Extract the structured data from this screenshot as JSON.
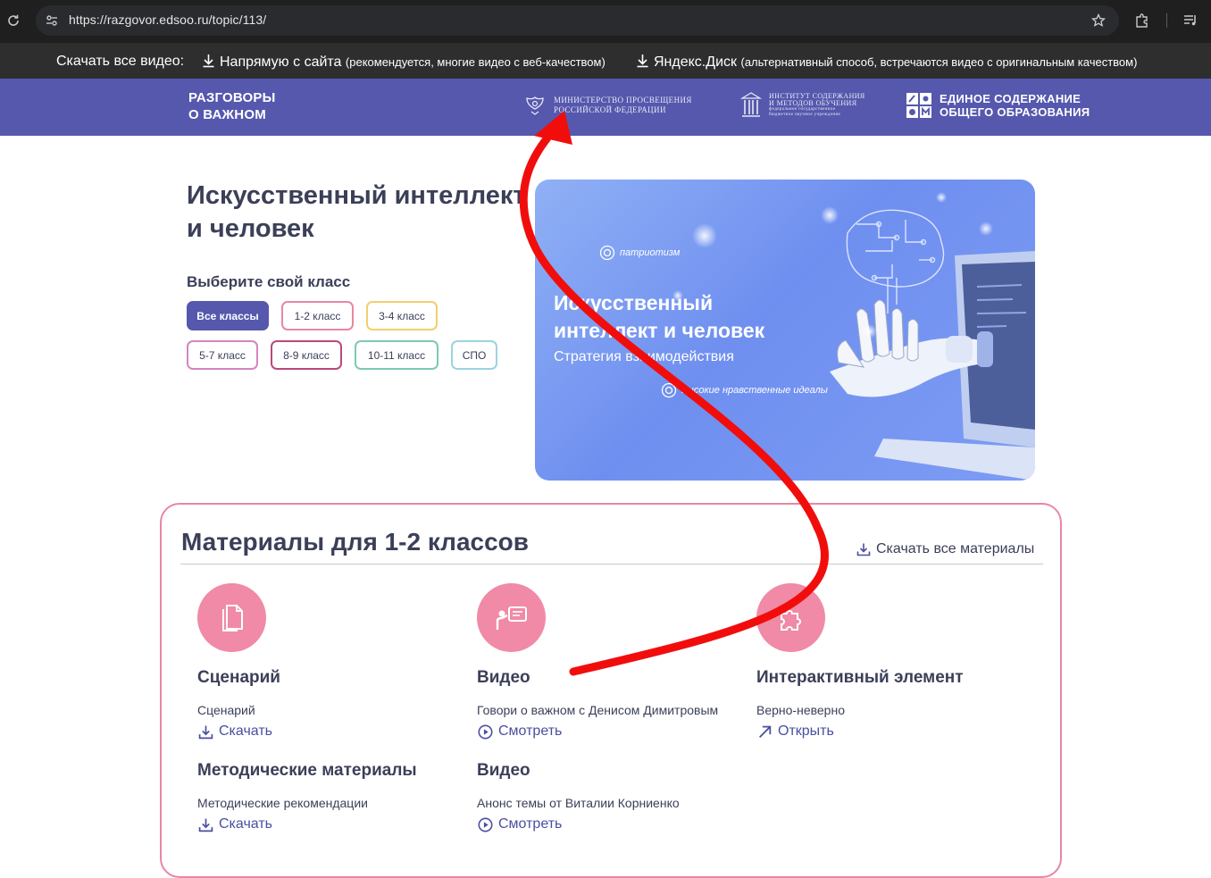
{
  "browser": {
    "url": "https://razgovor.edsoo.ru/topic/113/"
  },
  "download_bar": {
    "label": "Скачать все видео:",
    "direct_main": "Напрямую с сайта",
    "direct_note": "(рекомендуется, многие видео с веб-качеством)",
    "yandex_main": "Яндекс.Диск",
    "yandex_note": "(альтернативный способ, встречаются видео с оригинальным качеством)"
  },
  "header": {
    "brand_line1": "РАЗГОВОРЫ",
    "brand_line2": "О ВАЖНОМ",
    "ministry_line1": "МИНИСТЕРСТВО ПРОСВЕЩЕНИЯ",
    "ministry_line2": "РОССИЙСКОЙ ФЕДЕРАЦИИ",
    "institute_line1": "ИНСТИТУТ СОДЕРЖАНИЯ",
    "institute_line2": "И МЕТОДОВ ОБУЧЕНИЯ",
    "institute_line3": "федеральное государственное",
    "institute_line4": "бюджетное научное учреждение",
    "edu_line1": "ЕДИНОЕ СОДЕРЖАНИЕ",
    "edu_line2": "ОБЩЕГО ОБРАЗОВАНИЯ"
  },
  "hero": {
    "title": "Искусственный интеллект и человек",
    "class_label": "Выберите свой класс",
    "chips": [
      "Все классы",
      "1-2 класс",
      "3-4 класс",
      "5-7 класс",
      "8-9 класс",
      "10-11 класс",
      "СПО"
    ],
    "banner": {
      "tag_top": "патриотизм",
      "title_line1": "Искусственный",
      "title_line2": "интеллект и человек",
      "subtitle": "Стратегия взаимодействия",
      "tag_bottom": "высокие нравственные идеалы"
    }
  },
  "materials": {
    "title": "Материалы для 1-2 классов",
    "download_all": "Скачать все материалы",
    "items": [
      {
        "heading": "Сценарий",
        "desc": "Сценарий",
        "action": "Скачать"
      },
      {
        "heading": "Видео",
        "desc": "Говори о важном с Денисом Димитровым",
        "action": "Смотреть"
      },
      {
        "heading": "Интерактивный элемент",
        "desc": "Верно-неверно",
        "action": "Открыть"
      },
      {
        "heading": "Методические материалы",
        "desc": "Методические рекомендации",
        "action": "Скачать"
      },
      {
        "heading": "Видео",
        "desc": "Анонс темы от Виталии Корниенко",
        "action": "Смотреть"
      }
    ]
  },
  "colors": {
    "header_bg": "#5558ad",
    "accent_pink": "#f08aa6",
    "arrow_red": "#f20d0d"
  },
  "icons": [
    "reload-icon",
    "site-info-icon",
    "star-icon",
    "extensions-icon",
    "reading-list-icon",
    "download-icon",
    "document-icon",
    "presentation-icon",
    "puzzle-icon",
    "play-icon",
    "open-arrow-icon"
  ]
}
